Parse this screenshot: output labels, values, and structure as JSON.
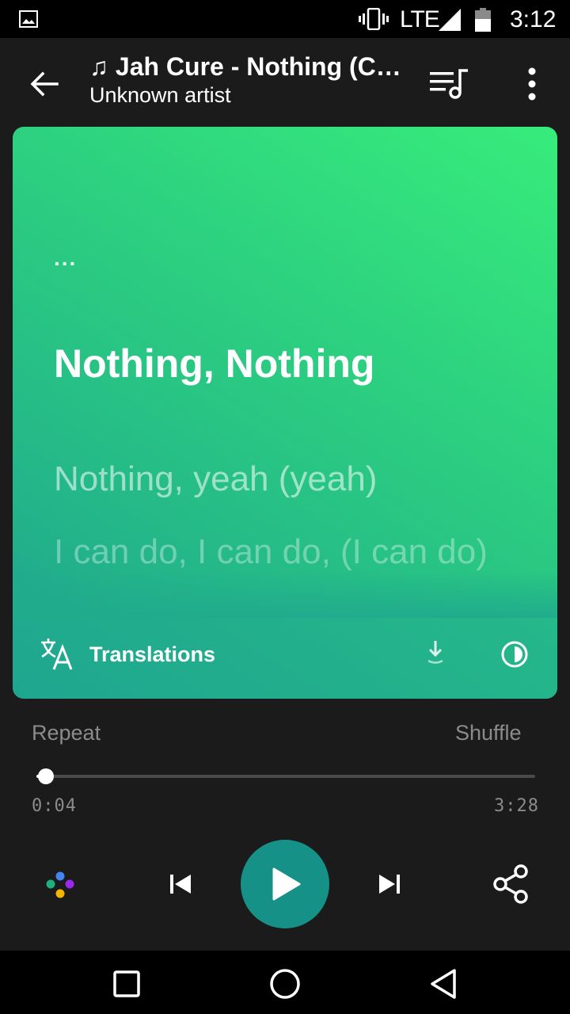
{
  "status_bar": {
    "network": "LTE",
    "time": "3:12",
    "icons": [
      "gallery-icon",
      "vibrate-icon",
      "signal-icon",
      "battery-icon"
    ]
  },
  "app_bar": {
    "title": "♫ Jah Cure - Nothing (Car...",
    "subtitle": "Unknown artist",
    "icons": [
      "back-arrow-icon",
      "queue-music-icon",
      "more-vertical-icon"
    ]
  },
  "lyrics": {
    "ellipsis": "...",
    "current_line": "Nothing, Nothing",
    "next_line": "Nothing, yeah (yeah)",
    "following_line": "I can do, I can do, (I can do)",
    "accent_color": "#2ccf80"
  },
  "lyrics_footer": {
    "translations_label": "Translations",
    "icons": [
      "translate-icon",
      "download-icon",
      "theme-icon"
    ]
  },
  "player": {
    "repeat_label": "Repeat",
    "shuffle_label": "Shuffle",
    "elapsed": "0:04",
    "duration": "3:28",
    "progress_fraction": 0.019,
    "play_button_color": "#159187",
    "icons": [
      "assistant-icon",
      "skip-previous-icon",
      "play-icon",
      "skip-next-icon",
      "share-icon"
    ]
  },
  "nav_bar": {
    "icons": [
      "recents-icon",
      "home-icon",
      "back-triangle-icon"
    ]
  }
}
